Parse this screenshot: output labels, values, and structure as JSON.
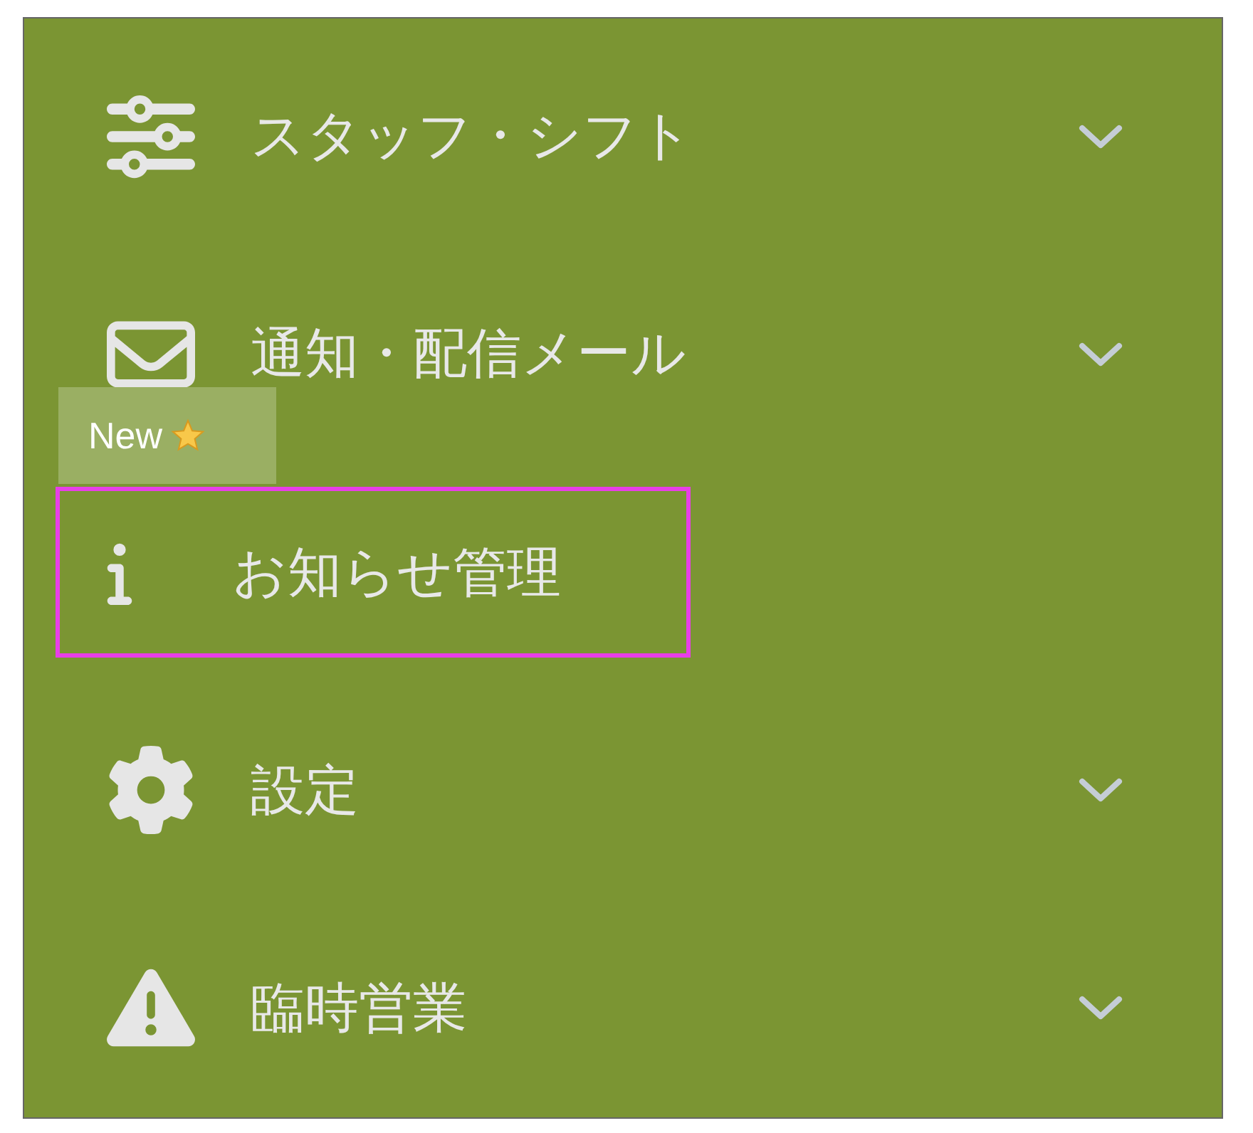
{
  "menu": {
    "items": [
      {
        "label": "スタッフ・シフト",
        "expandable": true,
        "selected": false
      },
      {
        "label": "通知・配信メール",
        "expandable": true,
        "selected": false
      },
      {
        "label": "お知らせ管理",
        "expandable": false,
        "selected": true,
        "badge": "New"
      },
      {
        "label": "設定",
        "expandable": true,
        "selected": false
      },
      {
        "label": "臨時営業",
        "expandable": true,
        "selected": false
      }
    ]
  }
}
